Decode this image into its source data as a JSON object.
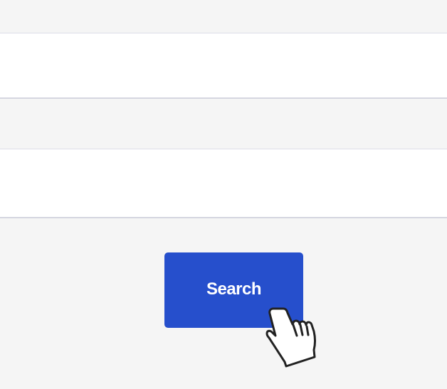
{
  "form": {
    "field_1": {
      "value": "",
      "placeholder": ""
    },
    "field_2": {
      "value": "",
      "placeholder": ""
    },
    "search_button_label": "Search"
  },
  "colors": {
    "background": "#f5f5f5",
    "field_background": "#ffffff",
    "button_background": "#264fcc",
    "button_text": "#ffffff"
  },
  "cursor": {
    "icon": "hand-pointer-icon"
  }
}
